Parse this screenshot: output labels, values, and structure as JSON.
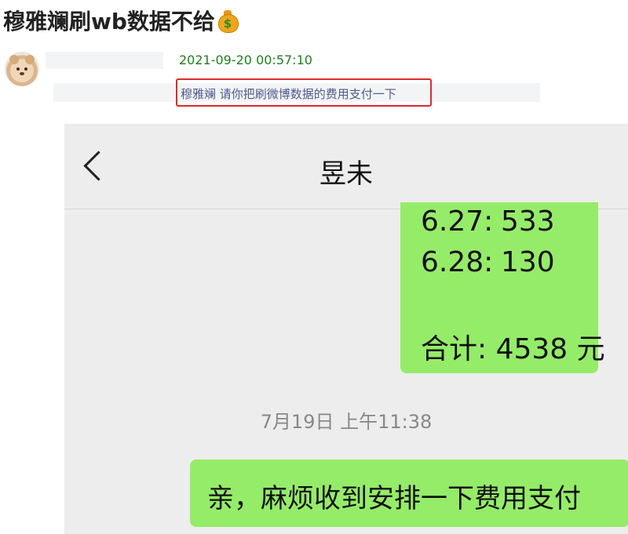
{
  "post": {
    "title": "穆雅斓刷wb数据不给",
    "title_emoji": "money-bag-icon",
    "timestamp": "2021-09-20 00:57:10",
    "comment": "穆雅斓 请你把刷微博数据的费用支付一下"
  },
  "chat": {
    "contact_name": "昱未",
    "rows": [
      {
        "label": "6.27:",
        "value": "533"
      },
      {
        "label": "6.28:",
        "value": "130"
      }
    ],
    "total_label": "合计:",
    "total_value": "4538 元",
    "time_divider": "7月19日 上午11:38",
    "last_message": "亲，麻烦收到安排一下费用支付"
  },
  "colors": {
    "timestamp": "#1e7e1e",
    "highlight_box": "#e0282a",
    "bubble_sent": "#95ec69",
    "chat_bg": "#ededed"
  }
}
